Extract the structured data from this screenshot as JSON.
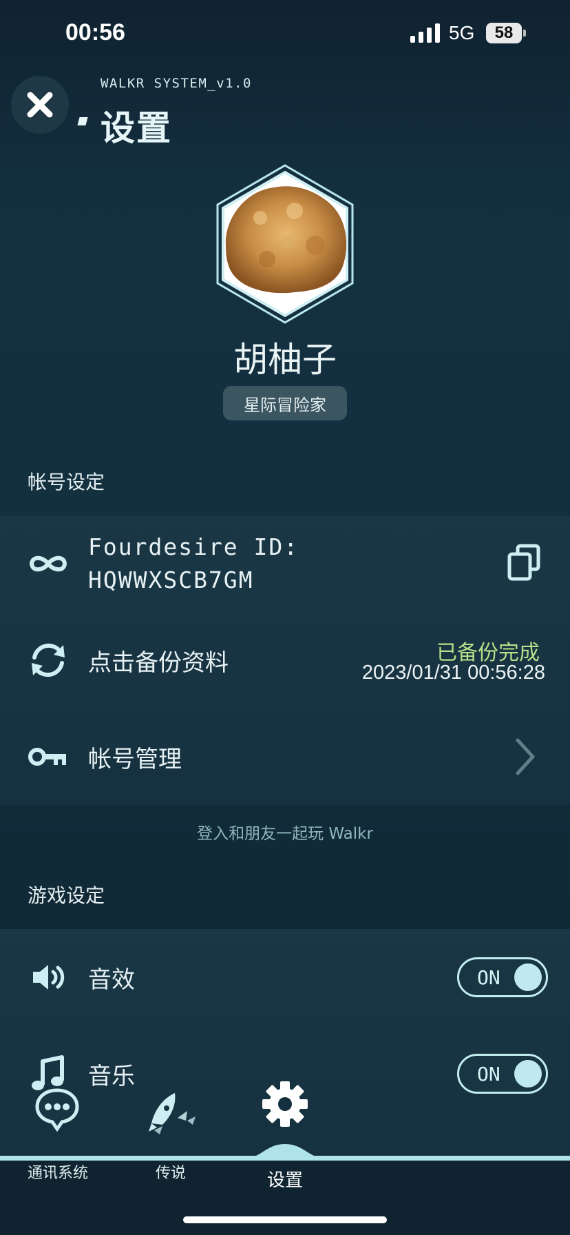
{
  "status_bar": {
    "time": "00:56",
    "network": "5G",
    "battery": "58"
  },
  "header": {
    "system_label": "WALKR SYSTEM_v1.0",
    "title": "设置"
  },
  "profile": {
    "name": "胡柚子",
    "rank": "星际冒险家"
  },
  "account_section": {
    "title": "帐号设定",
    "id_label": "Fourdesire ID:",
    "id_value": "HQWWXSCB7GM",
    "backup_label": "点击备份资料",
    "backup_status": "已备份完成",
    "backup_time": "2023/01/31 00:56:28",
    "manage_label": "帐号管理"
  },
  "login_hint": "登入和朋友一起玩 Walkr",
  "game_section": {
    "title": "游戏设定",
    "sound_label": "音效",
    "sound_toggle": "ON",
    "music_label": "音乐",
    "music_toggle": "ON"
  },
  "tabs": [
    {
      "label": "通讯系统",
      "icon": "chat-icon"
    },
    {
      "label": "传说",
      "icon": "rocket-icon"
    },
    {
      "label": "设置",
      "icon": "gear-icon"
    }
  ],
  "colors": {
    "background": "#13303f",
    "accent": "#aee3ea",
    "success": "#b8e089"
  }
}
